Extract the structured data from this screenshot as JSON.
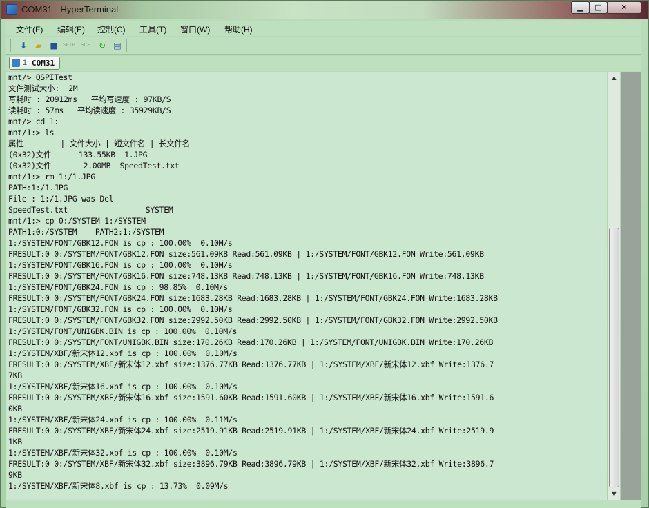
{
  "window": {
    "title": "COM31 - HyperTerminal"
  },
  "controls": {
    "minimize": "▁",
    "maximize": "□",
    "close": "✕"
  },
  "menu": {
    "items": [
      "文件(F)",
      "编辑(E)",
      "控制(C)",
      "工具(T)",
      "窗口(W)",
      "帮助(H)"
    ]
  },
  "toolbar": {
    "sftp_label": "SFTP",
    "scp_label": "SCP",
    "icons": [
      "connect-icon",
      "open-folder-icon",
      "save-icon",
      "sftp-icon",
      "scp-icon",
      "reconnect-icon",
      "properties-icon"
    ]
  },
  "tabs": [
    {
      "number": "1",
      "label": "COM31"
    }
  ],
  "scrollbar": {
    "up": "▲",
    "down": "▼"
  },
  "terminal": {
    "lines": [
      "mnt/> QSPITest",
      "文件测试大小:  2M",
      "写耗时 : 20912ms   平均写速度 : 97KB/S",
      "读耗时 : 57ms   平均读速度 : 35929KB/S",
      "mnt/> cd 1:",
      "mnt/1:> ls",
      "属性        | 文件大小 | 短文件名 | 长文件名",
      "(0x32)文件      133.55KB  1.JPG",
      "(0x32)文件       2.00MB  SpeedTest.txt",
      "mnt/1:> rm 1:/1.JPG",
      "PATH:1:/1.JPG",
      "File : 1:/1.JPG was Del",
      "SpeedTest.txt                 SYSTEM",
      "mnt/1:> cp 0:/SYSTEM 1:/SYSTEM",
      "PATH1:0:/SYSTEM    PATH2:1:/SYSTEM",
      "1:/SYSTEM/FONT/GBK12.FON is cp : 100.00%  0.10M/s",
      "FRESULT:0 0:/SYSTEM/FONT/GBK12.FON size:561.09KB Read:561.09KB | 1:/SYSTEM/FONT/GBK12.FON Write:561.09KB",
      "1:/SYSTEM/FONT/GBK16.FON is cp : 100.00%  0.10M/s",
      "FRESULT:0 0:/SYSTEM/FONT/GBK16.FON size:748.13KB Read:748.13KB | 1:/SYSTEM/FONT/GBK16.FON Write:748.13KB",
      "1:/SYSTEM/FONT/GBK24.FON is cp : 98.85%  0.10M/s",
      "FRESULT:0 0:/SYSTEM/FONT/GBK24.FON size:1683.28KB Read:1683.28KB | 1:/SYSTEM/FONT/GBK24.FON Write:1683.28KB",
      "1:/SYSTEM/FONT/GBK32.FON is cp : 100.00%  0.10M/s",
      "FRESULT:0 0:/SYSTEM/FONT/GBK32.FON size:2992.50KB Read:2992.50KB | 1:/SYSTEM/FONT/GBK32.FON Write:2992.50KB",
      "1:/SYSTEM/FONT/UNIGBK.BIN is cp : 100.00%  0.10M/s",
      "FRESULT:0 0:/SYSTEM/FONT/UNIGBK.BIN size:170.26KB Read:170.26KB | 1:/SYSTEM/FONT/UNIGBK.BIN Write:170.26KB",
      "1:/SYSTEM/XBF/新宋体12.xbf is cp : 100.00%  0.10M/s",
      "FRESULT:0 0:/SYSTEM/XBF/新宋体12.xbf size:1376.77KB Read:1376.77KB | 1:/SYSTEM/XBF/新宋体12.xbf Write:1376.7",
      "7KB",
      "1:/SYSTEM/XBF/新宋体16.xbf is cp : 100.00%  0.10M/s",
      "FRESULT:0 0:/SYSTEM/XBF/新宋体16.xbf size:1591.60KB Read:1591.60KB | 1:/SYSTEM/XBF/新宋体16.xbf Write:1591.6",
      "0KB",
      "1:/SYSTEM/XBF/新宋体24.xbf is cp : 100.00%  0.11M/s",
      "FRESULT:0 0:/SYSTEM/XBF/新宋体24.xbf size:2519.91KB Read:2519.91KB | 1:/SYSTEM/XBF/新宋体24.xbf Write:2519.9",
      "1KB",
      "1:/SYSTEM/XBF/新宋体32.xbf is cp : 100.00%  0.10M/s",
      "FRESULT:0 0:/SYSTEM/XBF/新宋体32.xbf size:3896.79KB Read:3896.79KB | 1:/SYSTEM/XBF/新宋体32.xbf Write:3896.7",
      "9KB",
      "1:/SYSTEM/XBF/新宋体8.xbf is cp : 13.73%  0.09M/s"
    ]
  },
  "colors": {
    "terminal_bg": "#cbe7cf",
    "chrome_bg": "#bfe0bf",
    "text": "#111111"
  }
}
